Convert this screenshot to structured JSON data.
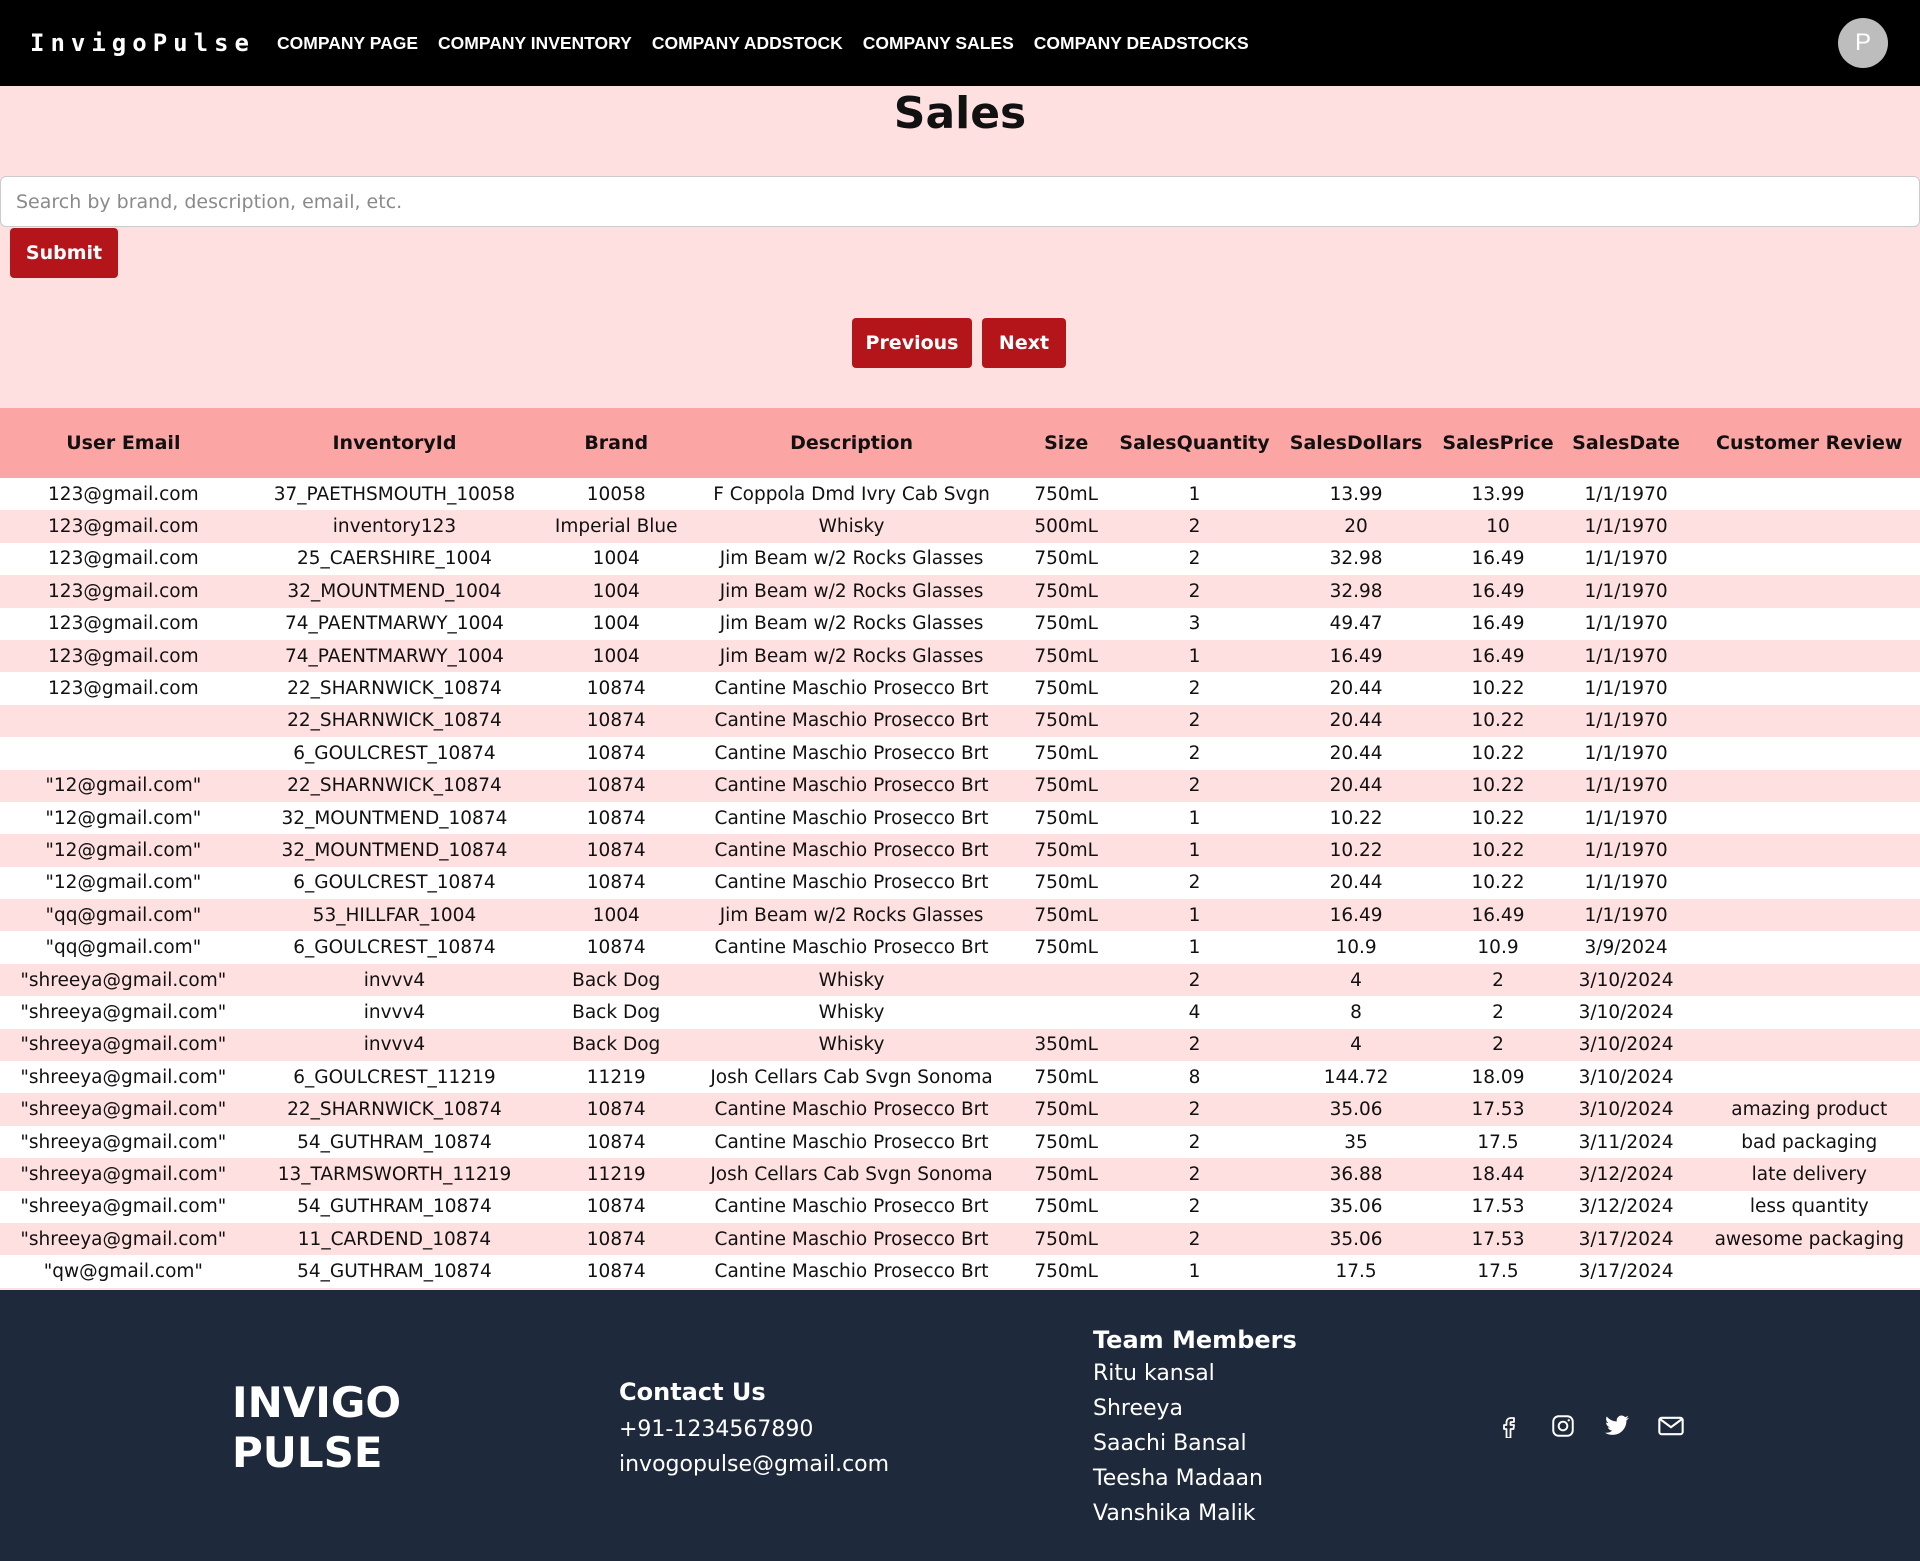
{
  "navbar": {
    "brand": "InvigoPulse",
    "links": [
      "COMPANY PAGE",
      "COMPANY INVENTORY",
      "COMPANY ADDSTOCK",
      "COMPANY SALES",
      "COMPANY DEADSTOCKS"
    ],
    "avatar_letter": "P"
  },
  "page": {
    "title": "Sales"
  },
  "search": {
    "placeholder": "Search by brand, description, email, etc.",
    "value": "",
    "submit_label": "Submit"
  },
  "pagination": {
    "previous_label": "Previous",
    "next_label": "Next"
  },
  "table": {
    "columns": [
      "User Email",
      "InventoryId",
      "Brand",
      "Description",
      "Size",
      "SalesQuantity",
      "SalesDollars",
      "SalesPrice",
      "SalesDate",
      "Customer Review"
    ],
    "rows": [
      [
        "123@gmail.com",
        "37_PAETHSMOUTH_10058",
        "10058",
        "F Coppola Dmd Ivry Cab Svgn",
        "750mL",
        "1",
        "13.99",
        "13.99",
        "1/1/1970",
        ""
      ],
      [
        "123@gmail.com",
        "inventory123",
        "Imperial Blue",
        "Whisky",
        "500mL",
        "2",
        "20",
        "10",
        "1/1/1970",
        ""
      ],
      [
        "123@gmail.com",
        "25_CAERSHIRE_1004",
        "1004",
        "Jim Beam w/2 Rocks Glasses",
        "750mL",
        "2",
        "32.98",
        "16.49",
        "1/1/1970",
        ""
      ],
      [
        "123@gmail.com",
        "32_MOUNTMEND_1004",
        "1004",
        "Jim Beam w/2 Rocks Glasses",
        "750mL",
        "2",
        "32.98",
        "16.49",
        "1/1/1970",
        ""
      ],
      [
        "123@gmail.com",
        "74_PAENTMARWY_1004",
        "1004",
        "Jim Beam w/2 Rocks Glasses",
        "750mL",
        "3",
        "49.47",
        "16.49",
        "1/1/1970",
        ""
      ],
      [
        "123@gmail.com",
        "74_PAENTMARWY_1004",
        "1004",
        "Jim Beam w/2 Rocks Glasses",
        "750mL",
        "1",
        "16.49",
        "16.49",
        "1/1/1970",
        ""
      ],
      [
        "123@gmail.com",
        "22_SHARNWICK_10874",
        "10874",
        "Cantine Maschio Prosecco Brt",
        "750mL",
        "2",
        "20.44",
        "10.22",
        "1/1/1970",
        ""
      ],
      [
        "",
        "22_SHARNWICK_10874",
        "10874",
        "Cantine Maschio Prosecco Brt",
        "750mL",
        "2",
        "20.44",
        "10.22",
        "1/1/1970",
        ""
      ],
      [
        "",
        "6_GOULCREST_10874",
        "10874",
        "Cantine Maschio Prosecco Brt",
        "750mL",
        "2",
        "20.44",
        "10.22",
        "1/1/1970",
        ""
      ],
      [
        "\"12@gmail.com\"",
        "22_SHARNWICK_10874",
        "10874",
        "Cantine Maschio Prosecco Brt",
        "750mL",
        "2",
        "20.44",
        "10.22",
        "1/1/1970",
        ""
      ],
      [
        "\"12@gmail.com\"",
        "32_MOUNTMEND_10874",
        "10874",
        "Cantine Maschio Prosecco Brt",
        "750mL",
        "1",
        "10.22",
        "10.22",
        "1/1/1970",
        ""
      ],
      [
        "\"12@gmail.com\"",
        "32_MOUNTMEND_10874",
        "10874",
        "Cantine Maschio Prosecco Brt",
        "750mL",
        "1",
        "10.22",
        "10.22",
        "1/1/1970",
        ""
      ],
      [
        "\"12@gmail.com\"",
        "6_GOULCREST_10874",
        "10874",
        "Cantine Maschio Prosecco Brt",
        "750mL",
        "2",
        "20.44",
        "10.22",
        "1/1/1970",
        ""
      ],
      [
        "\"qq@gmail.com\"",
        "53_HILLFAR_1004",
        "1004",
        "Jim Beam w/2 Rocks Glasses",
        "750mL",
        "1",
        "16.49",
        "16.49",
        "1/1/1970",
        ""
      ],
      [
        "\"qq@gmail.com\"",
        "6_GOULCREST_10874",
        "10874",
        "Cantine Maschio Prosecco Brt",
        "750mL",
        "1",
        "10.9",
        "10.9",
        "3/9/2024",
        ""
      ],
      [
        "\"shreeya@gmail.com\"",
        "invvv4",
        "Back Dog",
        "Whisky",
        "",
        "2",
        "4",
        "2",
        "3/10/2024",
        ""
      ],
      [
        "\"shreeya@gmail.com\"",
        "invvv4",
        "Back Dog",
        "Whisky",
        "",
        "4",
        "8",
        "2",
        "3/10/2024",
        ""
      ],
      [
        "\"shreeya@gmail.com\"",
        "invvv4",
        "Back Dog",
        "Whisky",
        "350mL",
        "2",
        "4",
        "2",
        "3/10/2024",
        ""
      ],
      [
        "\"shreeya@gmail.com\"",
        "6_GOULCREST_11219",
        "11219",
        "Josh Cellars Cab Svgn Sonoma",
        "750mL",
        "8",
        "144.72",
        "18.09",
        "3/10/2024",
        ""
      ],
      [
        "\"shreeya@gmail.com\"",
        "22_SHARNWICK_10874",
        "10874",
        "Cantine Maschio Prosecco Brt",
        "750mL",
        "2",
        "35.06",
        "17.53",
        "3/10/2024",
        "amazing product"
      ],
      [
        "\"shreeya@gmail.com\"",
        "54_GUTHRAM_10874",
        "10874",
        "Cantine Maschio Prosecco Brt",
        "750mL",
        "2",
        "35",
        "17.5",
        "3/11/2024",
        "bad packaging"
      ],
      [
        "\"shreeya@gmail.com\"",
        "13_TARMSWORTH_11219",
        "11219",
        "Josh Cellars Cab Svgn Sonoma",
        "750mL",
        "2",
        "36.88",
        "18.44",
        "3/12/2024",
        "late delivery"
      ],
      [
        "\"shreeya@gmail.com\"",
        "54_GUTHRAM_10874",
        "10874",
        "Cantine Maschio Prosecco Brt",
        "750mL",
        "2",
        "35.06",
        "17.53",
        "3/12/2024",
        "less quantity"
      ],
      [
        "\"shreeya@gmail.com\"",
        "11_CARDEND_10874",
        "10874",
        "Cantine Maschio Prosecco Brt",
        "750mL",
        "2",
        "35.06",
        "17.53",
        "3/17/2024",
        "awesome packaging"
      ],
      [
        "\"qw@gmail.com\"",
        "54_GUTHRAM_10874",
        "10874",
        "Cantine Maschio Prosecco Brt",
        "750mL",
        "1",
        "17.5",
        "17.5",
        "3/17/2024",
        ""
      ]
    ]
  },
  "footer": {
    "logo_line1": "INVIGO",
    "logo_line2": "PULSE",
    "contact_heading": "Contact Us",
    "phone": "+91-1234567890",
    "email": "invogopulse@gmail.com",
    "team_heading": "Team Members",
    "team_members": [
      "Ritu kansal",
      "Shreeya",
      "Saachi Bansal",
      "Teesha Madaan",
      "Vanshika Malik"
    ],
    "social_icons": [
      "facebook-icon",
      "instagram-icon",
      "twitter-icon",
      "mail-icon"
    ]
  },
  "colors": {
    "navbar_bg": "#000000",
    "page_bg": "#ffe0e1",
    "button_bg": "#b3151b",
    "table_header_bg": "#fca5a5",
    "footer_bg": "#1e293b"
  }
}
